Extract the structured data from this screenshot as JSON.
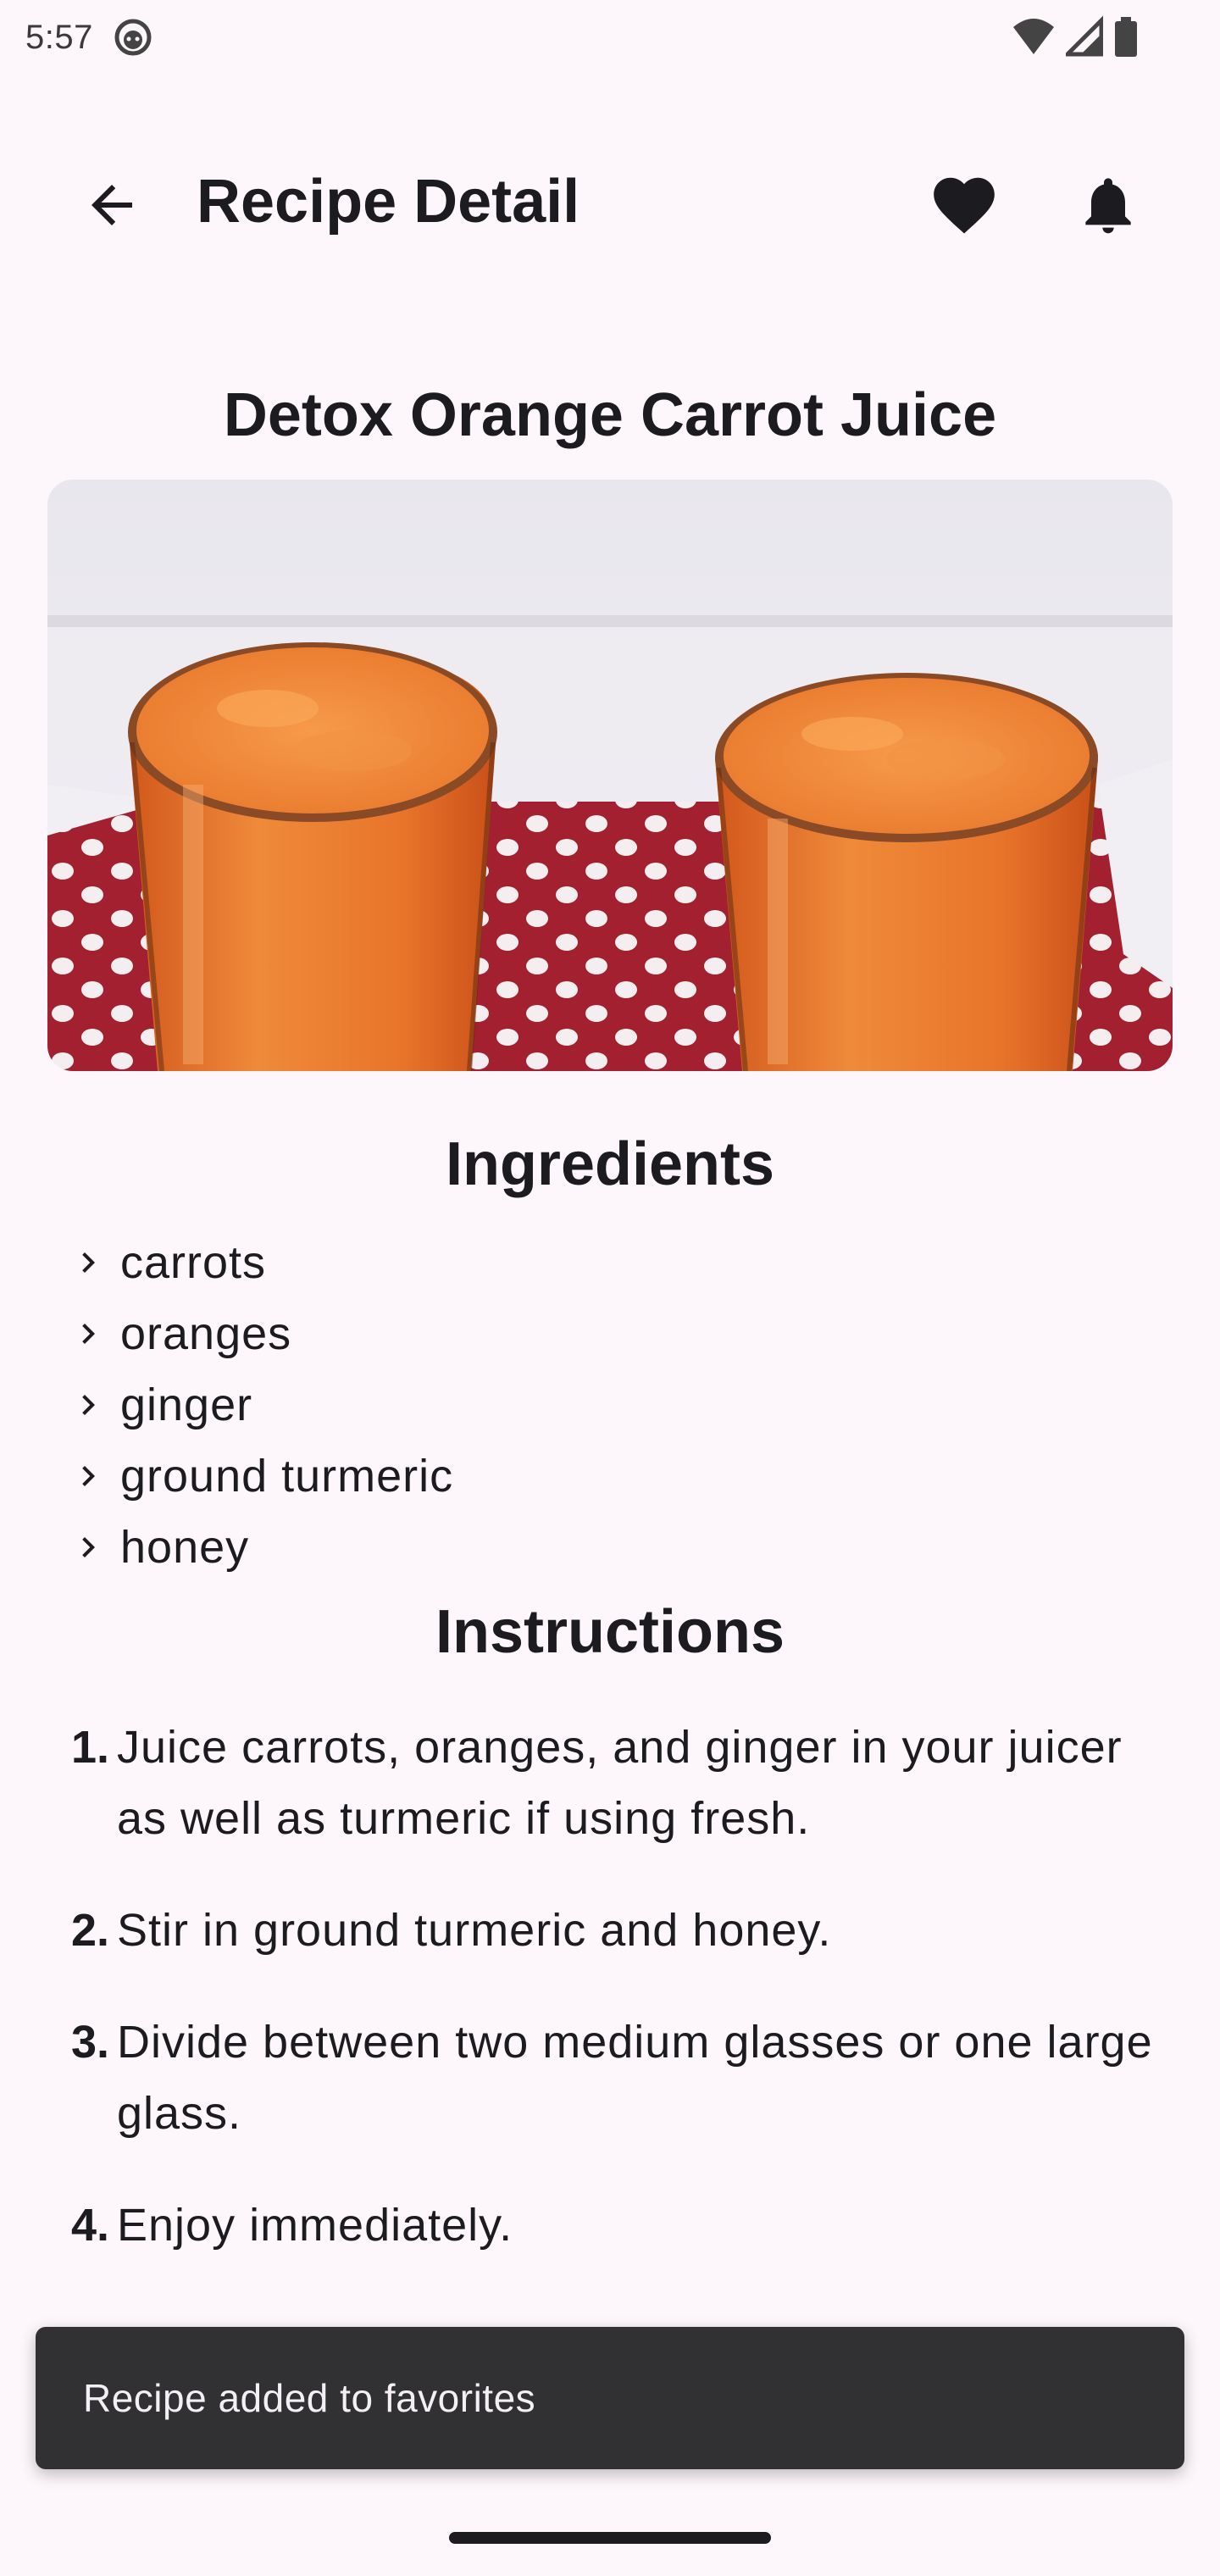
{
  "status_bar": {
    "time": "5:57"
  },
  "app_bar": {
    "title": "Recipe Detail",
    "back_icon": "arrow-back-icon",
    "favorite_icon": "heart-icon",
    "notification_icon": "bell-icon"
  },
  "recipe": {
    "title": "Detox Orange Carrot Juice",
    "ingredients_header": "Ingredients",
    "ingredients": [
      "carrots",
      "oranges",
      "ginger",
      "ground turmeric",
      "honey"
    ],
    "instructions_header": "Instructions",
    "instructions": [
      {
        "number": "1.",
        "text": "Juice carrots, oranges, and ginger in your juicer as well as turmeric if using fresh."
      },
      {
        "number": "2.",
        "text": "Stir in ground turmeric and honey."
      },
      {
        "number": "3.",
        "text": "Divide between two medium glasses or one large glass."
      },
      {
        "number": "4.",
        "text": "Enjoy immediately."
      }
    ]
  },
  "snackbar": {
    "message": "Recipe added to favorites"
  },
  "colors": {
    "background": "#fdf7fb",
    "text": "#1c1b1f",
    "snackbar": "#313033",
    "juice": "#e8742a",
    "towel": "#a32030"
  }
}
